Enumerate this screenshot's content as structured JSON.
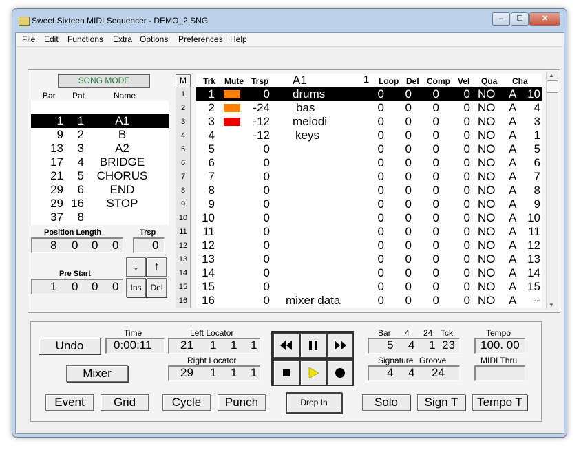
{
  "window": {
    "title": "Sweet Sixteen MIDI Sequencer - DEMO_2.SNG",
    "min": "–",
    "max": "☐",
    "close": "✕"
  },
  "menu": [
    "File",
    "Edit",
    "Functions",
    "Extra",
    "Options",
    "Preferences",
    "Help"
  ],
  "song": {
    "mode_label": "SONG MODE",
    "headers": {
      "bar": "Bar",
      "pat": "Pat",
      "name": "Name"
    },
    "rows": [
      {
        "bar": "1",
        "pat": "1",
        "name": "A1",
        "selected": true
      },
      {
        "bar": "9",
        "pat": "2",
        "name": "B"
      },
      {
        "bar": "13",
        "pat": "3",
        "name": "A2"
      },
      {
        "bar": "17",
        "pat": "4",
        "name": "BRIDGE"
      },
      {
        "bar": "21",
        "pat": "5",
        "name": "CHORUS"
      },
      {
        "bar": "29",
        "pat": "6",
        "name": "END"
      },
      {
        "bar": "29",
        "pat": "16",
        "name": "STOP"
      },
      {
        "bar": "37",
        "pat": "8",
        "name": ""
      }
    ],
    "position_length_label": "Position Length",
    "position_length": [
      "8",
      "0",
      "0",
      "0"
    ],
    "trsp_label": "Trsp",
    "trsp_value": "0",
    "pre_start_label": "Pre Start",
    "pre_start": [
      "1",
      "0",
      "0",
      "0"
    ],
    "down_arrow": "↓",
    "up_arrow": "↑",
    "ins_label": "Ins",
    "del_label": "Del"
  },
  "tracks": {
    "m_label": "M",
    "headers": {
      "trk": "Trk",
      "mute": "Mute",
      "trsp": "Trsp",
      "pattern": "A1",
      "pattern_num": "1",
      "loop": "Loop",
      "del": "Del",
      "comp": "Comp",
      "vel": "Vel",
      "qua": "Qua",
      "cha": "Cha"
    },
    "rows": [
      {
        "n": "1",
        "trk": "1",
        "mute": "#ff8000",
        "trsp": "0",
        "name": "drums",
        "loop": "0",
        "del": "0",
        "comp": "0",
        "vel": "0",
        "qua": "NO",
        "cha_p": "A",
        "cha": "10",
        "selected": true
      },
      {
        "n": "2",
        "trk": "2",
        "mute": "#ff8000",
        "trsp": "-24",
        "name": "bas",
        "loop": "0",
        "del": "0",
        "comp": "0",
        "vel": "0",
        "qua": "NO",
        "cha_p": "A",
        "cha": "4"
      },
      {
        "n": "3",
        "trk": "3",
        "mute": "#ee0000",
        "trsp": "-12",
        "name": "melodi",
        "loop": "0",
        "del": "0",
        "comp": "0",
        "vel": "0",
        "qua": "NO",
        "cha_p": "A",
        "cha": "3"
      },
      {
        "n": "4",
        "trk": "4",
        "mute": "",
        "trsp": "-12",
        "name": "keys",
        "loop": "0",
        "del": "0",
        "comp": "0",
        "vel": "0",
        "qua": "NO",
        "cha_p": "A",
        "cha": "1"
      },
      {
        "n": "5",
        "trk": "5",
        "mute": "",
        "trsp": "0",
        "name": "",
        "loop": "0",
        "del": "0",
        "comp": "0",
        "vel": "0",
        "qua": "NO",
        "cha_p": "A",
        "cha": "5"
      },
      {
        "n": "6",
        "trk": "6",
        "mute": "",
        "trsp": "0",
        "name": "",
        "loop": "0",
        "del": "0",
        "comp": "0",
        "vel": "0",
        "qua": "NO",
        "cha_p": "A",
        "cha": "6"
      },
      {
        "n": "7",
        "trk": "7",
        "mute": "",
        "trsp": "0",
        "name": "",
        "loop": "0",
        "del": "0",
        "comp": "0",
        "vel": "0",
        "qua": "NO",
        "cha_p": "A",
        "cha": "7"
      },
      {
        "n": "8",
        "trk": "8",
        "mute": "",
        "trsp": "0",
        "name": "",
        "loop": "0",
        "del": "0",
        "comp": "0",
        "vel": "0",
        "qua": "NO",
        "cha_p": "A",
        "cha": "8"
      },
      {
        "n": "9",
        "trk": "9",
        "mute": "",
        "trsp": "0",
        "name": "",
        "loop": "0",
        "del": "0",
        "comp": "0",
        "vel": "0",
        "qua": "NO",
        "cha_p": "A",
        "cha": "9"
      },
      {
        "n": "10",
        "trk": "10",
        "mute": "",
        "trsp": "0",
        "name": "",
        "loop": "0",
        "del": "0",
        "comp": "0",
        "vel": "0",
        "qua": "NO",
        "cha_p": "A",
        "cha": "10"
      },
      {
        "n": "11",
        "trk": "11",
        "mute": "",
        "trsp": "0",
        "name": "",
        "loop": "0",
        "del": "0",
        "comp": "0",
        "vel": "0",
        "qua": "NO",
        "cha_p": "A",
        "cha": "11"
      },
      {
        "n": "12",
        "trk": "12",
        "mute": "",
        "trsp": "0",
        "name": "",
        "loop": "0",
        "del": "0",
        "comp": "0",
        "vel": "0",
        "qua": "NO",
        "cha_p": "A",
        "cha": "12"
      },
      {
        "n": "13",
        "trk": "13",
        "mute": "",
        "trsp": "0",
        "name": "",
        "loop": "0",
        "del": "0",
        "comp": "0",
        "vel": "0",
        "qua": "NO",
        "cha_p": "A",
        "cha": "13"
      },
      {
        "n": "14",
        "trk": "14",
        "mute": "",
        "trsp": "0",
        "name": "",
        "loop": "0",
        "del": "0",
        "comp": "0",
        "vel": "0",
        "qua": "NO",
        "cha_p": "A",
        "cha": "14"
      },
      {
        "n": "15",
        "trk": "15",
        "mute": "",
        "trsp": "0",
        "name": "",
        "loop": "0",
        "del": "0",
        "comp": "0",
        "vel": "0",
        "qua": "NO",
        "cha_p": "A",
        "cha": "15"
      },
      {
        "n": "16",
        "trk": "16",
        "mute": "",
        "trsp": "0",
        "name": "mixer data",
        "loop": "0",
        "del": "0",
        "comp": "0",
        "vel": "0",
        "qua": "NO",
        "cha_p": "A",
        "cha": "--"
      }
    ]
  },
  "transport": {
    "undo": "Undo",
    "mixer": "Mixer",
    "time_label": "Time",
    "time": "0:00:11",
    "left_locator_label": "Left Locator",
    "left_locator": [
      "21",
      "1",
      "1",
      "1"
    ],
    "right_locator_label": "Right Locator",
    "right_locator": [
      "29",
      "1",
      "1",
      "1"
    ],
    "bar_header": {
      "bar": "Bar",
      "beat": "4",
      "sub": "24",
      "tck": "Tck"
    },
    "bar_values": [
      "5",
      "4",
      "1",
      "23"
    ],
    "signature_label": "Signature",
    "groove_label": "Groove",
    "signature_values": [
      "4",
      "4",
      "24"
    ],
    "tempo_label": "Tempo",
    "tempo": "100. 00",
    "midi_thru_label": "MIDI Thru",
    "midi_thru": "",
    "drop_in": "Drop In",
    "bottom_buttons": {
      "event": "Event",
      "grid": "Grid",
      "cycle": "Cycle",
      "punch": "Punch",
      "solo": "Solo",
      "sign_t": "Sign T",
      "tempo_t": "Tempo T"
    }
  }
}
